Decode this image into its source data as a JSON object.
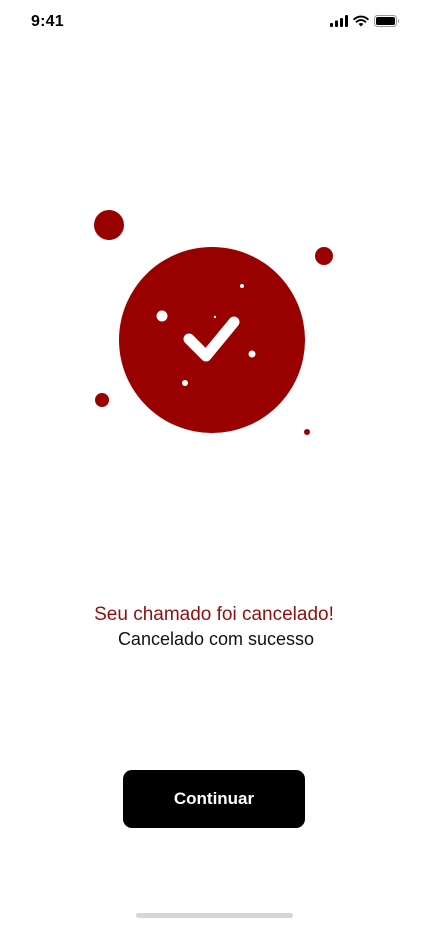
{
  "status_bar": {
    "time": "9:41",
    "icons": [
      "cellular-signal-icon",
      "wifi-icon",
      "battery-icon"
    ]
  },
  "illustration": {
    "icon": "checkmark-icon",
    "accent_color": "#990000"
  },
  "message": {
    "title": "Seu chamado foi cancelado!",
    "subtitle": "Cancelado com sucesso"
  },
  "actions": {
    "continue_label": "Continuar"
  },
  "colors": {
    "accent": "#990000",
    "title_text": "#8f0f0f",
    "button_bg": "#000000",
    "button_text": "#ffffff"
  }
}
